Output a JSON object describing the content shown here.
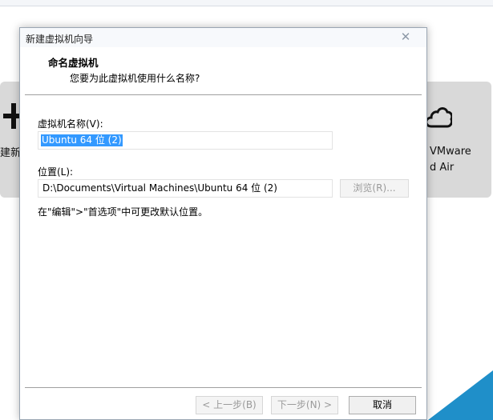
{
  "background": {
    "left_text": "建新的",
    "right_text_line1": "VMware",
    "right_text_line2": "d Air",
    "accent_color": "#1f8fc9",
    "icons": [
      "plus-icon",
      "cloud-icon"
    ]
  },
  "dialog": {
    "title": "新建虚拟机向导",
    "heading": "命名虚拟机",
    "subheading": "您要为此虚拟机使用什么名称?",
    "name_label": "虚拟机名称(V):",
    "name_value": "Ubuntu 64 位 (2)",
    "location_label": "位置(L):",
    "location_value": "D:\\Documents\\Virtual Machines\\Ubuntu 64 位 (2)",
    "browse_label": "浏览(R)...",
    "hint": "在\"编辑\">\"首选项\"中可更改默认位置。",
    "back_label": "< 上一步(B)",
    "next_label": "下一步(N) >",
    "cancel_label": "取消",
    "close_icon": "close-icon"
  }
}
